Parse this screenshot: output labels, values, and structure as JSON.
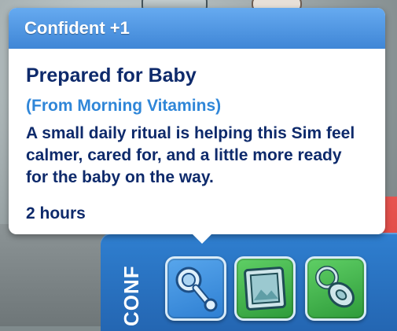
{
  "tooltip": {
    "header": "Confident +1",
    "title": "Prepared for Baby",
    "source": "(From Morning Vitamins)",
    "description": "A small daily ritual is helping this Sim feel calmer, cared for, and a little more ready for the baby on the way.",
    "duration": "2 hours",
    "colors": {
      "header": "#3f86d6",
      "title": "#0e2a6b",
      "source": "#2f86d8"
    }
  },
  "panel": {
    "label": "CONF",
    "color": "#2f7fd0"
  },
  "moodlets": [
    {
      "icon": "baby-rattle-icon",
      "color": "#2e7fd2"
    },
    {
      "icon": "picture-frame-icon",
      "color": "#2e9b3a"
    },
    {
      "icon": "pacifier-icon",
      "color": "#2e9b3a"
    }
  ]
}
